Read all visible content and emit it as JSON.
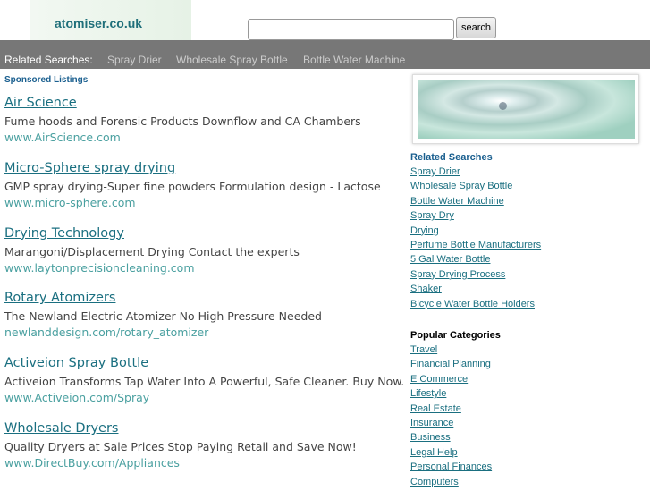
{
  "header": {
    "site_name": "atomiser.co.uk",
    "search_placeholder": "",
    "search_button": "search"
  },
  "related_bar": {
    "label": "Related Searches:",
    "items": [
      "Spray Drier",
      "Wholesale Spray Bottle",
      "Bottle Water Machine"
    ]
  },
  "sponsored_title": "Sponsored Listings",
  "ads": [
    {
      "title": "Air Science",
      "desc": "Fume hoods and Forensic Products Downflow and CA Chambers",
      "url": "www.AirScience.com"
    },
    {
      "title": "Micro-Sphere spray drying",
      "desc": "GMP spray drying-Super fine powders Formulation design - Lactose",
      "url": "www.micro-sphere.com"
    },
    {
      "title": "Drying Technology",
      "desc": "Marangoni/Displacement Drying Contact the experts",
      "url": "www.laytonprecisioncleaning.com"
    },
    {
      "title": "Rotary Atomizers",
      "desc": "The Newland Electric Atomizer No High Pressure Needed",
      "url": "newlanddesign.com/rotary_atomizer"
    },
    {
      "title": "Activeion Spray Bottle",
      "desc": "Activeion Transforms Tap Water Into A Powerful, Safe Cleaner. Buy Now.",
      "url": "www.Activeion.com/Spray"
    },
    {
      "title": "Wholesale Dryers",
      "desc": "Quality Dryers at Sale Prices Stop Paying Retail and Save Now!",
      "url": "www.DirectBuy.com/Appliances"
    }
  ],
  "related_searches": {
    "title": "Related Searches",
    "items": [
      "Spray Drier",
      "Wholesale Spray Bottle",
      "Bottle Water Machine",
      "Spray Dry",
      "Drying",
      "Perfume Bottle Manufacturers",
      "5 Gal Water Bottle",
      "Spray Drying Process",
      "Shaker",
      "Bicycle Water Bottle Holders"
    ]
  },
  "popular_categories": {
    "title": "Popular Categories",
    "items": [
      "Travel",
      "Financial Planning",
      "E Commerce",
      "Lifestyle",
      "Real Estate",
      "Insurance",
      "Business",
      "Legal Help",
      "Personal Finances",
      "Computers"
    ]
  }
}
